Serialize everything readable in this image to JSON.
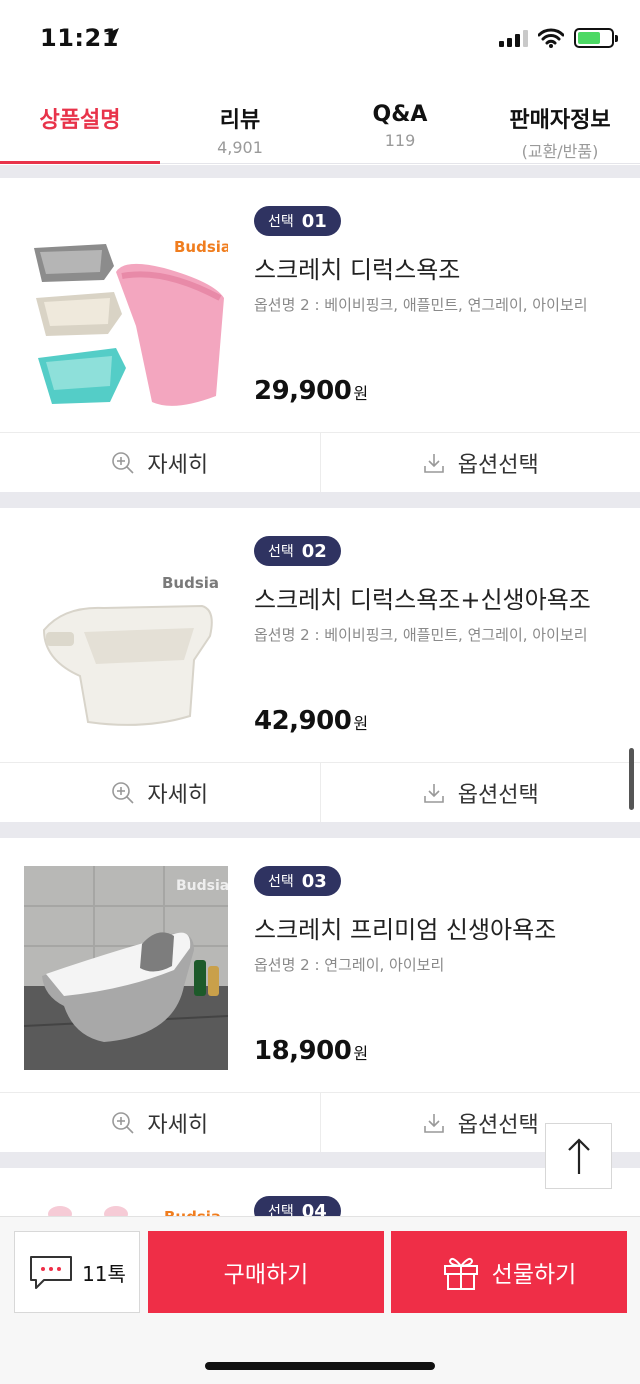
{
  "status_bar": {
    "time": "11:21"
  },
  "tabs": [
    {
      "label": "상품설명",
      "sub": ""
    },
    {
      "label": "리뷰",
      "sub": "4,901"
    },
    {
      "label": "Q&A",
      "sub": "119"
    },
    {
      "label": "판매자정보",
      "sub": "(교환/반품)"
    }
  ],
  "products": [
    {
      "badge_label": "선택",
      "badge_num": "01",
      "title": "스크레치 디럭스욕조",
      "option": "옵션명 2 : 베이비핑크, 애플민트, 연그레이, 아이보리",
      "price": "29,900",
      "price_unit": "원",
      "brand": "Budsia"
    },
    {
      "badge_label": "선택",
      "badge_num": "02",
      "title": "스크레치 디럭스욕조+신생아욕조",
      "option": "옵션명 2 : 베이비핑크, 애플민트, 연그레이, 아이보리",
      "price": "42,900",
      "price_unit": "원",
      "brand": "Budsia"
    },
    {
      "badge_label": "선택",
      "badge_num": "03",
      "title": "스크레치 프리미엄 신생아욕조",
      "option": "옵션명 2 : 연그레이, 아이보리",
      "price": "18,900",
      "price_unit": "원",
      "brand": "Budsia"
    },
    {
      "badge_label": "선택",
      "badge_num": "04",
      "brand": "Budsia"
    }
  ],
  "actions": {
    "detail": "자세히",
    "option": "옵션선택"
  },
  "bottom_bar": {
    "talk": "11톡",
    "buy": "구매하기",
    "gift": "선물하기"
  },
  "colors": {
    "accent": "#ef2e47",
    "badge": "#2f3361"
  }
}
